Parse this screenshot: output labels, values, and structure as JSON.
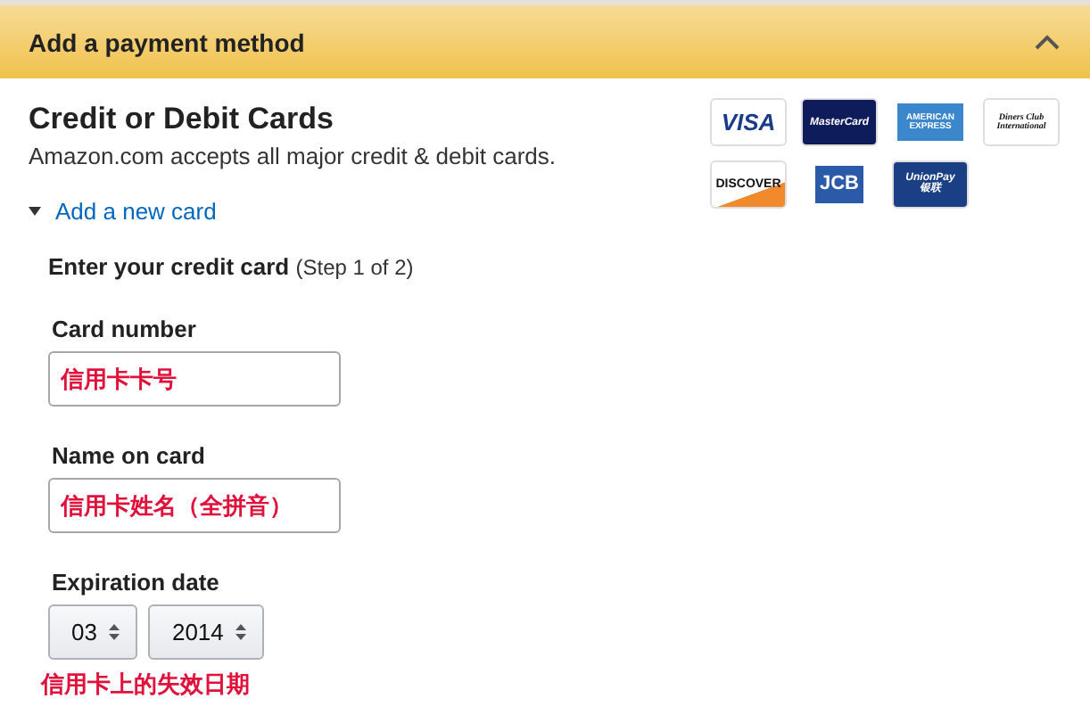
{
  "header": {
    "title": "Add a payment method",
    "expanded": true
  },
  "section": {
    "title": "Credit or Debit Cards",
    "subtitle": "Amazon.com accepts all major credit & debit cards."
  },
  "cards": [
    {
      "kind": "visa",
      "label": "VISA"
    },
    {
      "kind": "mastercard",
      "label": "MasterCard"
    },
    {
      "kind": "amex",
      "label": "AMERICAN EXPRESS"
    },
    {
      "kind": "diners",
      "label": "Diners Club International"
    },
    {
      "kind": "discover",
      "label": "DISCOVER"
    },
    {
      "kind": "jcb",
      "label": "JCB"
    },
    {
      "kind": "unionpay",
      "label": "UnionPay",
      "sublabel": "银联"
    }
  ],
  "add_card": {
    "label": "Add a new card",
    "expanded": true
  },
  "step": {
    "title": "Enter your credit card",
    "note": "(Step 1 of 2)"
  },
  "fields": [
    {
      "label": "Card number",
      "value": "信用卡卡号"
    },
    {
      "label": "Name on card",
      "value": "信用卡姓名（全拼音）"
    }
  ],
  "expiration": {
    "label": "Expiration date",
    "month": "03",
    "year": "2014",
    "note": "信用卡上的失效日期"
  }
}
